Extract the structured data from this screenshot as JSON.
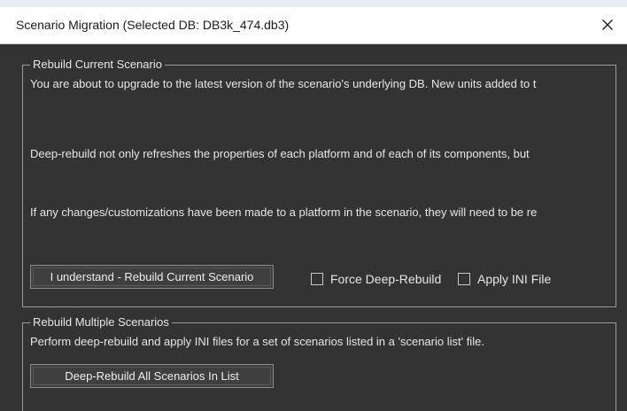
{
  "window": {
    "title": "Scenario Migration (Selected DB: DB3k_474.db3)",
    "close_icon": "close-icon"
  },
  "rebuild_current": {
    "legend": "Rebuild Current Scenario",
    "paragraph_1": "You are about to upgrade to the latest version of the scenario's underlying DB. New units added to t",
    "paragraph_2": "Deep-rebuild not only refreshes the properties of each platform and of each of its components, but",
    "paragraph_3": "If any changes/customizations have been made to a platform in the scenario, they will need to be re",
    "button_label": "I understand - Rebuild Current Scenario",
    "force_deep_rebuild_label": "Force Deep-Rebuild",
    "force_deep_rebuild_checked": false,
    "apply_ini_label": "Apply INI File",
    "apply_ini_checked": false
  },
  "rebuild_multiple": {
    "legend": "Rebuild Multiple Scenarios",
    "description": "Perform deep-rebuild and apply INI files for a set of scenarios listed in a 'scenario list' file.",
    "button_label": "Deep-Rebuild All Scenarios In List"
  },
  "colors": {
    "background": "#333333",
    "titlebar": "#ffffff",
    "text": "#e6e6e6",
    "border": "#9a9a9a"
  }
}
